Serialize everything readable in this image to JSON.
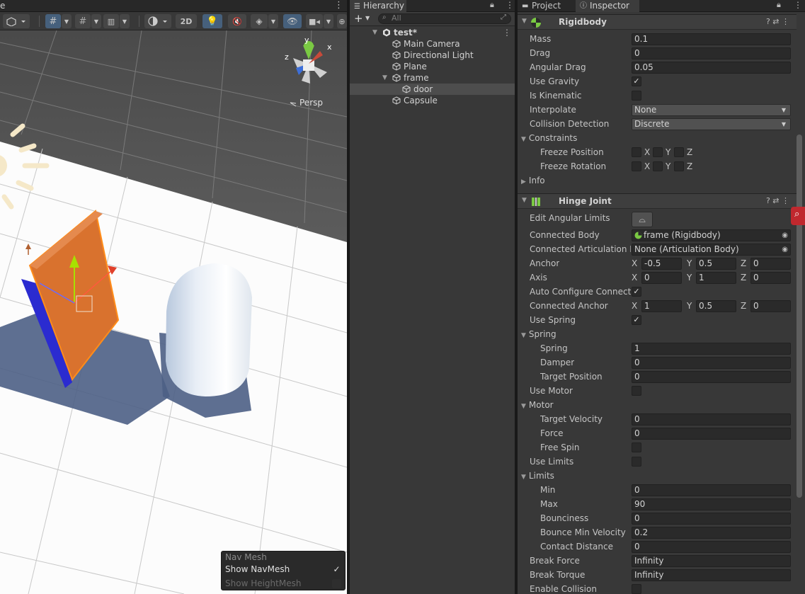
{
  "scene": {
    "tab_title": "e",
    "toolbar": {
      "btn_2d": "2D"
    },
    "gizmo": {
      "persp_label": "Persp",
      "axis_x": "x",
      "axis_y": "y",
      "axis_z": "z"
    },
    "navmesh": {
      "title": "Nav Mesh",
      "show_navmesh": "Show NavMesh",
      "show_navmesh_checked": "✓",
      "show_heightmesh": "Show HeightMesh"
    }
  },
  "hierarchy": {
    "tab_title": "Hierarchy",
    "search_placeholder": "All",
    "add_button": "+",
    "items": [
      {
        "label": "test*",
        "depth": 0,
        "expanded": true,
        "selected": false,
        "icon": "unity-scene-icon"
      },
      {
        "label": "Main Camera",
        "depth": 1,
        "selected": false,
        "icon": "gameobject-icon"
      },
      {
        "label": "Directional Light",
        "depth": 1,
        "selected": false,
        "icon": "gameobject-icon"
      },
      {
        "label": "Plane",
        "depth": 1,
        "selected": false,
        "icon": "gameobject-icon"
      },
      {
        "label": "frame",
        "depth": 1,
        "expanded": true,
        "selected": false,
        "icon": "gameobject-icon"
      },
      {
        "label": "door",
        "depth": 2,
        "selected": true,
        "icon": "gameobject-icon"
      },
      {
        "label": "Capsule",
        "depth": 1,
        "selected": false,
        "icon": "gameobject-icon"
      }
    ]
  },
  "inspector": {
    "tabs": [
      {
        "label": "Project"
      },
      {
        "label": "Inspector"
      }
    ],
    "rigidbody": {
      "title": "Rigidbody",
      "mass_label": "Mass",
      "mass": "0.1",
      "drag_label": "Drag",
      "drag": "0",
      "angular_drag_label": "Angular Drag",
      "angular_drag": "0.05",
      "use_gravity_label": "Use Gravity",
      "use_gravity": "✓",
      "is_kinematic_label": "Is Kinematic",
      "is_kinematic": "",
      "interpolate_label": "Interpolate",
      "interpolate": "None",
      "collision_label": "Collision Detection",
      "collision": "Discrete",
      "constraints_label": "Constraints",
      "freeze_pos_label": "Freeze Position",
      "freeze_rot_label": "Freeze Rotation",
      "axis_x": "X",
      "axis_y": "Y",
      "axis_z": "Z",
      "info_label": "Info"
    },
    "hinge": {
      "title": "Hinge Joint",
      "edit_limits_label": "Edit Angular Limits",
      "connected_body_label": "Connected Body",
      "connected_body": "frame (Rigidbody)",
      "connected_art_label": "Connected Articulation Bo",
      "connected_art": "None (Articulation Body)",
      "anchor_label": "Anchor",
      "anchor": {
        "x": "-0.5",
        "y": "0.5",
        "z": "0"
      },
      "axis_label": "Axis",
      "axis": {
        "x": "0",
        "y": "1",
        "z": "0"
      },
      "auto_config_label": "Auto Configure Connecte",
      "auto_config": "✓",
      "conn_anchor_label": "Connected Anchor",
      "conn_anchor": {
        "x": "1",
        "y": "0.5",
        "z": "0"
      },
      "use_spring_label": "Use Spring",
      "use_spring": "✓",
      "spring_fold_label": "Spring",
      "spring_label": "Spring",
      "spring": "1",
      "damper_label": "Damper",
      "damper": "0",
      "target_pos_label": "Target Position",
      "target_pos": "0",
      "use_motor_label": "Use Motor",
      "use_motor": "",
      "motor_fold_label": "Motor",
      "target_vel_label": "Target Velocity",
      "target_vel": "0",
      "force_label": "Force",
      "force": "0",
      "free_spin_label": "Free Spin",
      "free_spin": "",
      "use_limits_label": "Use Limits",
      "use_limits": "",
      "limits_fold_label": "Limits",
      "min_label": "Min",
      "min": "0",
      "max_label": "Max",
      "max": "90",
      "bounciness_label": "Bounciness",
      "bounciness": "0",
      "bounce_min_label": "Bounce Min Velocity",
      "bounce_min": "0.2",
      "contact_label": "Contact Distance",
      "contact": "0",
      "break_force_label": "Break Force",
      "break_force": "Infinity",
      "break_torque_label": "Break Torque",
      "break_torque": "Infinity",
      "enable_collision_label": "Enable Collision",
      "enable_collision": ""
    }
  }
}
